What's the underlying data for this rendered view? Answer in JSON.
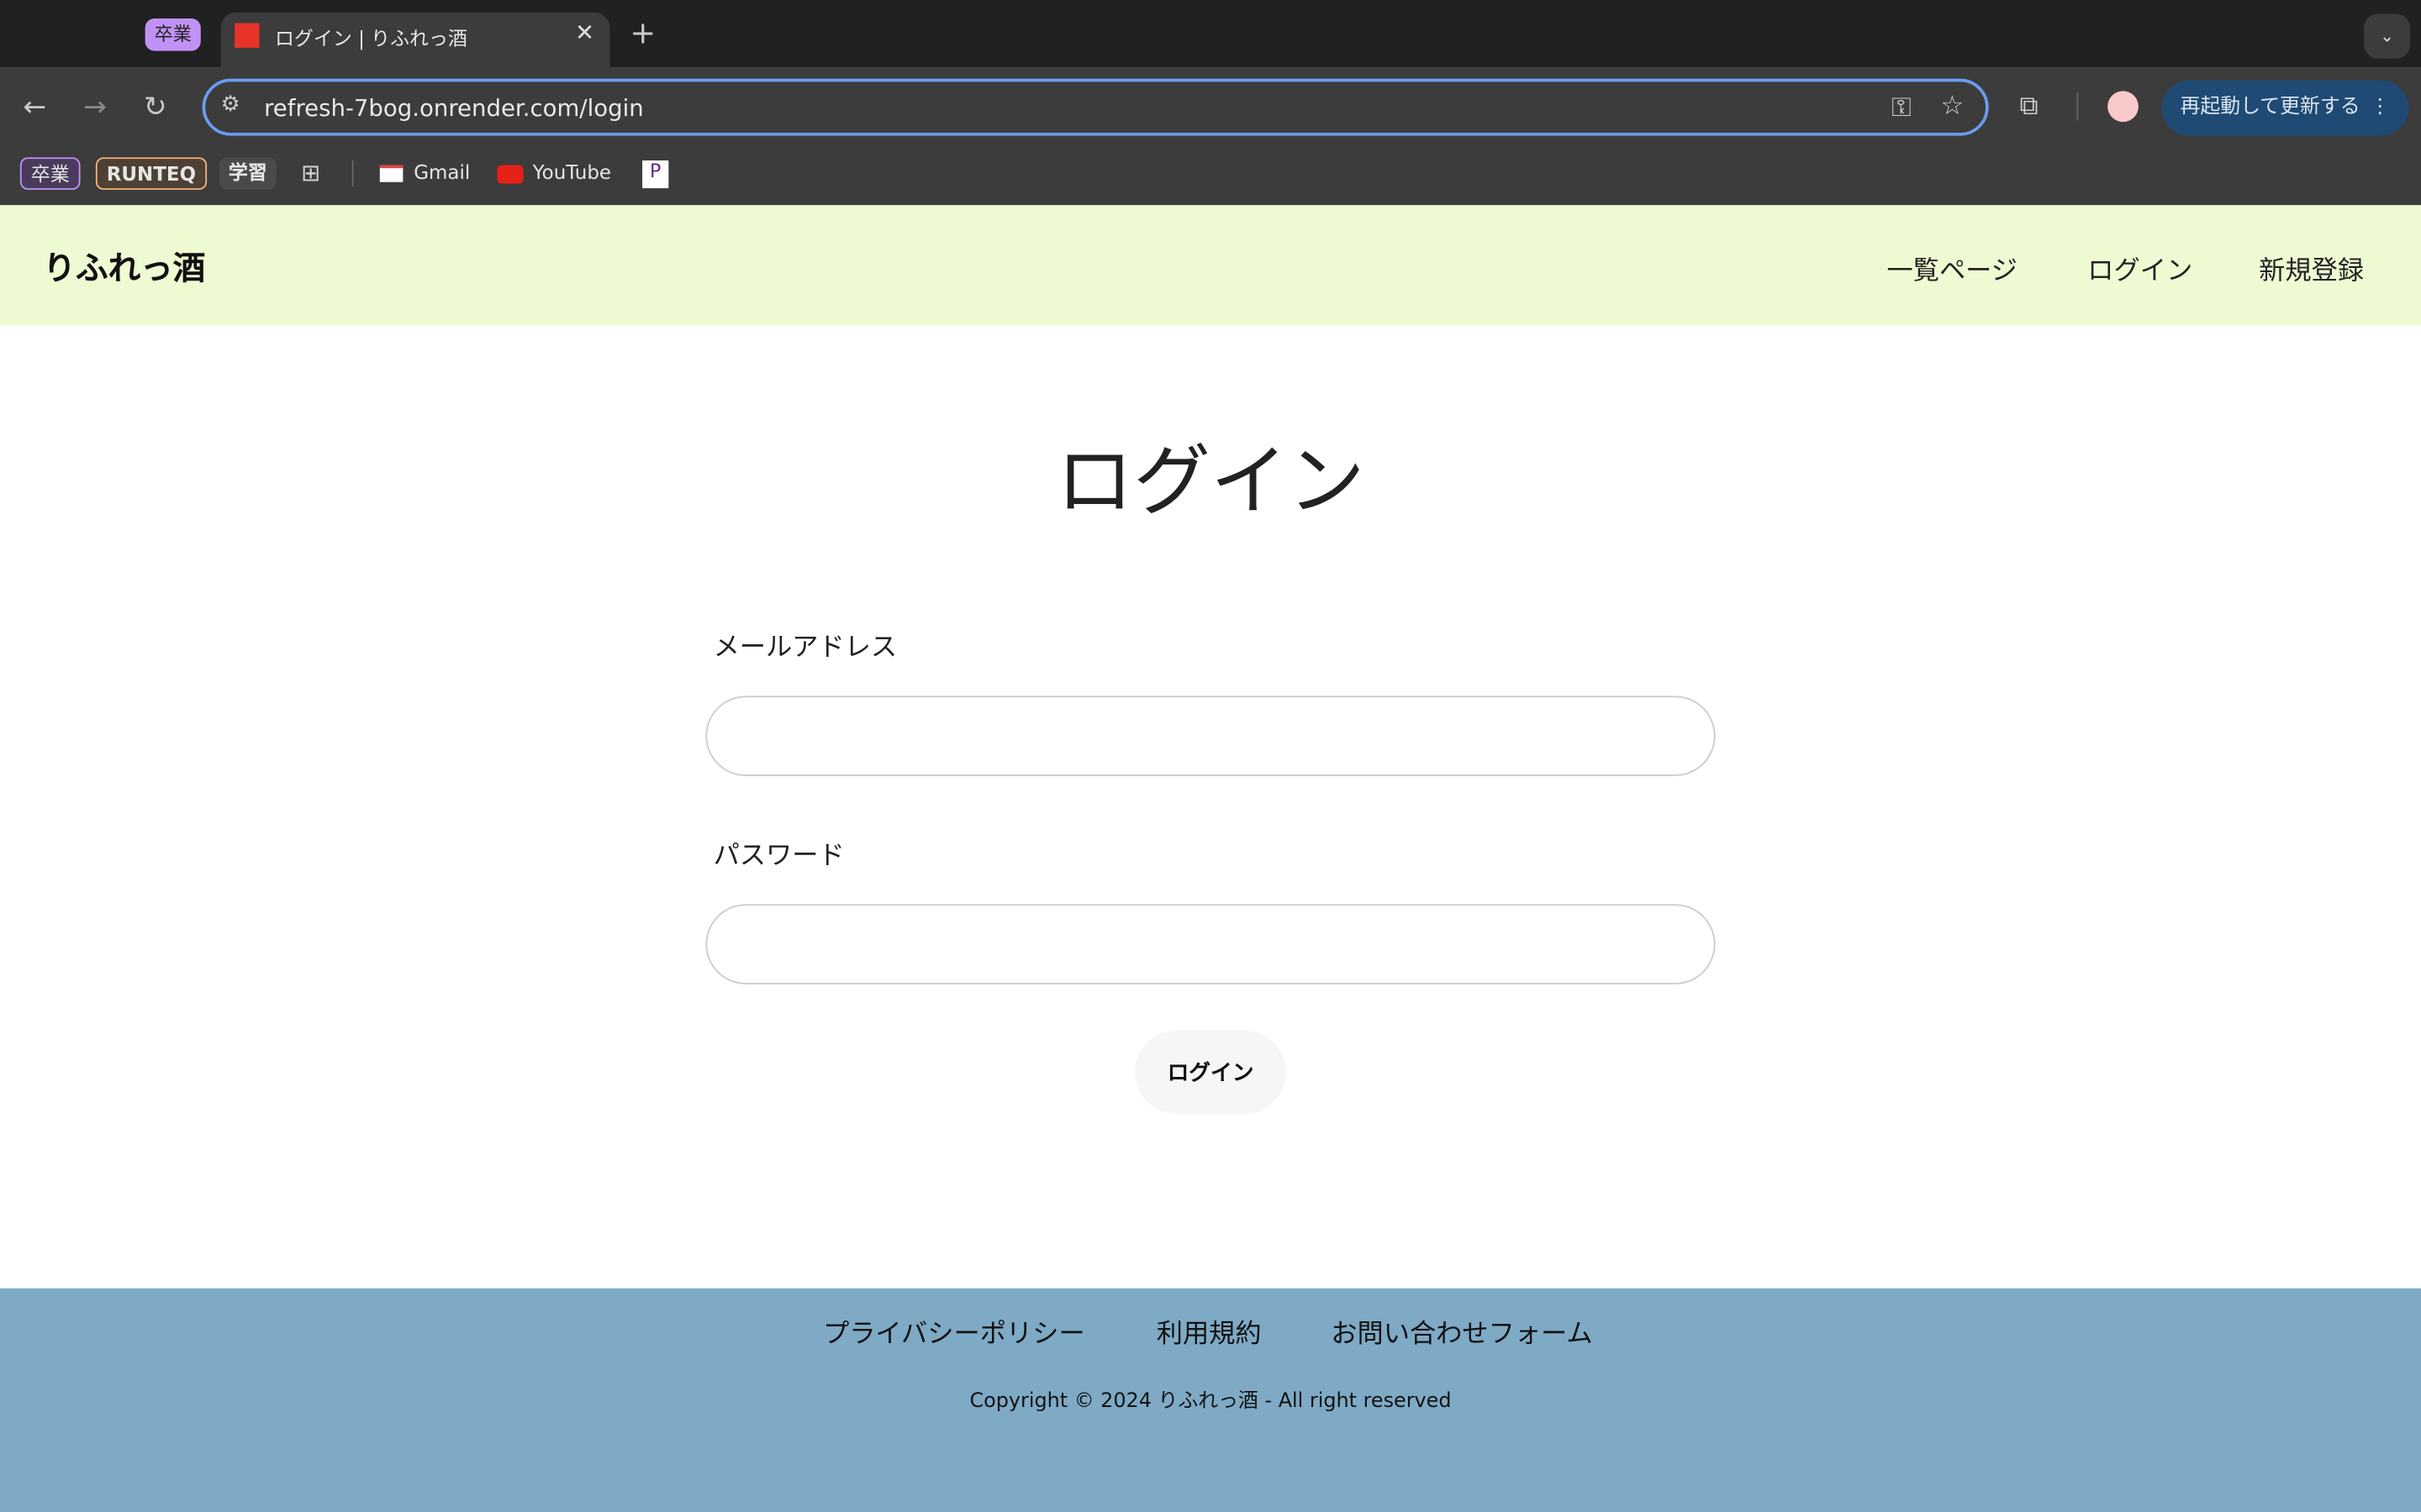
{
  "browser": {
    "tab_group": "卒業",
    "tab_title": "ログイン | りふれっ酒",
    "url": "refresh-7bog.onrender.com/login",
    "update_button": "再起動して更新する",
    "bookmarks": [
      {
        "label": "卒業"
      },
      {
        "label": "RUNTEQ"
      },
      {
        "label": "学習"
      },
      {
        "label": "Gmail"
      },
      {
        "label": "YouTube"
      }
    ],
    "colors": {
      "tab_group": "#c192f5",
      "omnibox_border": "#6b9cf0",
      "update": "#1f4a73"
    }
  },
  "header": {
    "logo": "りふれっ酒",
    "nav": [
      "一覧ページ",
      "ログイン",
      "新規登録"
    ],
    "background": "#eefbd2"
  },
  "main": {
    "title": "ログイン",
    "email_label": "メールアドレス",
    "password_label": "パスワード",
    "submit": "ログイン"
  },
  "footer": {
    "links": [
      "プライバシーポリシー",
      "利用規約",
      "お問い合わせフォーム"
    ],
    "copyright": "Copyright © 2024 りふれっ酒 - All right reserved",
    "background": "#7eaac6"
  }
}
